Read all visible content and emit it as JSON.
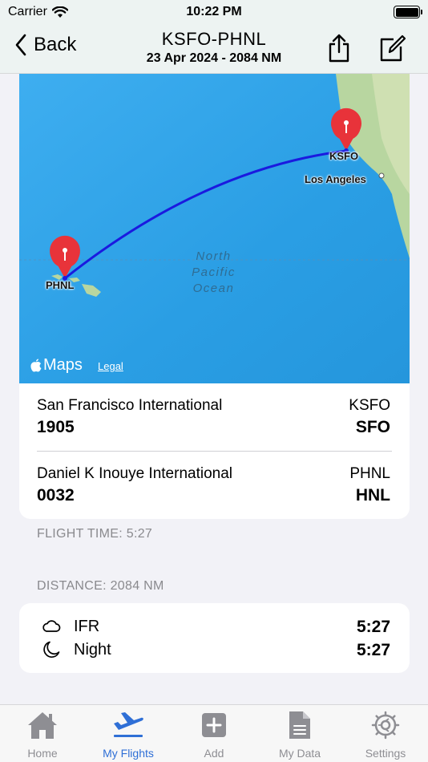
{
  "status_bar": {
    "carrier": "Carrier",
    "time": "10:22 PM"
  },
  "nav": {
    "back_label": "Back",
    "title": "KSFO-PHNL",
    "subtitle": "23 Apr 2024 - 2084 NM"
  },
  "map": {
    "origin_pin_label": "KSFO",
    "destination_pin_label": "PHNL",
    "city_label": "Los Angeles",
    "ocean_label_lines": [
      "North",
      "Pacific",
      "Ocean"
    ],
    "maps_brand": "Maps",
    "legal_label": "Legal",
    "route_color": "#1a1adf",
    "pin_color": "#e8333a"
  },
  "airports": [
    {
      "name": "San Francisco International",
      "time": "1905",
      "icao": "KSFO",
      "iata": "SFO"
    },
    {
      "name": "Daniel K Inouye International",
      "time": "0032",
      "icao": "PHNL",
      "iata": "HNL"
    }
  ],
  "flight_time_label": "FLIGHT TIME: 5:27",
  "distance_label": "DISTANCE: 2084 NM",
  "times": [
    {
      "icon": "cloud-icon",
      "label": "IFR",
      "value": "5:27"
    },
    {
      "icon": "moon-icon",
      "label": "Night",
      "value": "5:27"
    }
  ],
  "tabs": [
    {
      "icon": "home-icon",
      "label": "Home",
      "active": false
    },
    {
      "icon": "airplane-departure-icon",
      "label": "My Flights",
      "active": true
    },
    {
      "icon": "add-icon",
      "label": "Add",
      "active": false
    },
    {
      "icon": "document-icon",
      "label": "My Data",
      "active": false
    },
    {
      "icon": "gear-icon",
      "label": "Settings",
      "active": false
    }
  ],
  "colors": {
    "accent": "#2f6fd6",
    "inactive": "#8e8e93",
    "background": "#f2f2f7"
  }
}
